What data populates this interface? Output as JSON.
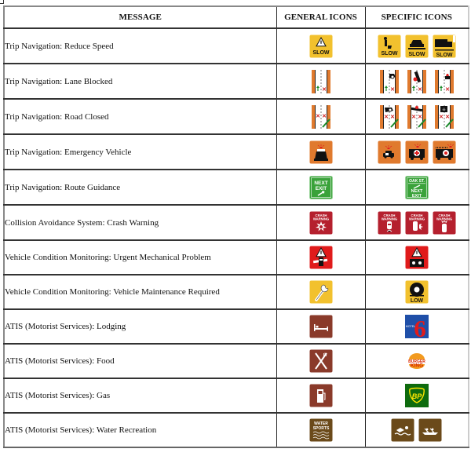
{
  "table": {
    "headers": {
      "message": "MESSAGE",
      "general": "GENERAL ICONS",
      "specific": "SPECIFIC ICONS"
    },
    "rows": [
      {
        "message": "Trip Navigation: Reduce Speed",
        "general_icons": [
          "slow-warning-icon"
        ],
        "specific_icons": [
          "slow-worker-icon",
          "slow-vehicle-icon",
          "slow-truck-icon"
        ]
      },
      {
        "message": "Trip Navigation: Lane Blocked",
        "general_icons": [
          "lane-blocked-icon"
        ],
        "specific_icons": [
          "lane-blocked-vehicle-icon",
          "lane-blocked-crash-icon",
          "lane-blocked-disabled-vehicle-icon"
        ]
      },
      {
        "message": "Trip Navigation: Road Closed",
        "general_icons": [
          "road-closed-icon"
        ],
        "specific_icons": [
          "road-closed-vehicle-icon",
          "road-closed-crash-icon",
          "road-closed-hazmat-icon"
        ]
      },
      {
        "message": "Trip Navigation: Emergency Vehicle",
        "general_icons": [
          "emergency-vehicle-icon"
        ],
        "specific_icons": [
          "police-car-icon",
          "ambulance-icon",
          "fire-truck-icon"
        ]
      },
      {
        "message": "Trip Navigation: Route Guidance",
        "general_icons": [
          "next-exit-icon"
        ],
        "specific_icons": [
          "oak-st-next-exit-icon"
        ]
      },
      {
        "message": "Collision Avoidance System: Crash Warning",
        "general_icons": [
          "crash-warning-icon"
        ],
        "specific_icons": [
          "crash-warning-rear-icon",
          "crash-warning-side-icon",
          "crash-warning-front-icon"
        ]
      },
      {
        "message": "Vehicle Condition Monitoring: Urgent Mechanical Problem",
        "general_icons": [
          "engine-warning-icon"
        ],
        "specific_icons": [
          "battery-warning-icon"
        ]
      },
      {
        "message": "Vehicle Condition Monitoring: Vehicle Maintenance Required",
        "general_icons": [
          "wrench-icon"
        ],
        "specific_icons": [
          "low-tire-icon"
        ]
      },
      {
        "message": "ATIS (Motorist Services):  Lodging",
        "general_icons": [
          "bed-icon"
        ],
        "specific_icons": [
          "motel-6-logo-icon"
        ]
      },
      {
        "message": "ATIS (Motorist Services):  Food",
        "general_icons": [
          "fork-knife-icon"
        ],
        "specific_icons": [
          "burger-king-logo-icon"
        ]
      },
      {
        "message": "ATIS (Motorist Services):  Gas",
        "general_icons": [
          "gas-pump-icon"
        ],
        "specific_icons": [
          "bp-logo-icon"
        ]
      },
      {
        "message": "ATIS (Motorist Services):  Water Recreation",
        "general_icons": [
          "water-sports-icon"
        ],
        "specific_icons": [
          "swimming-icon",
          "boating-icon"
        ]
      }
    ]
  },
  "icon_text": {
    "slow": "SLOW",
    "next": "NEXT",
    "exit": "EXIT",
    "oak_st": "OAK ST.",
    "crash": "CRASH",
    "warning": "WARNING",
    "low": "LOW",
    "motel": "MOTEL",
    "six": "6",
    "burger": "BURGER",
    "king": "KING",
    "bp": "BP",
    "water": "WATER",
    "sports": "SPORTS"
  },
  "colors": {
    "yellow": "#f2c12e",
    "orange": "#e07a2e",
    "green": "#3aa23a",
    "crash_red": "#b5202e",
    "alert_red": "#e01b1b",
    "brown": "#8a3a2a",
    "dark_brown": "#6b4a1a",
    "motel_blue": "#1f4fa8",
    "bp_green": "#0e6b0e"
  }
}
